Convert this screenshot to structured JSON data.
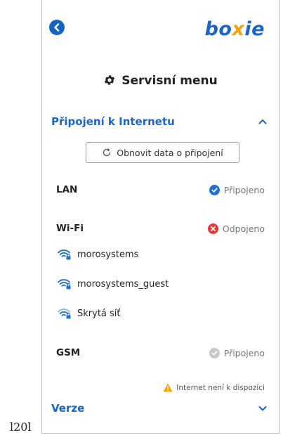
{
  "corner_label": "l20l",
  "header": {
    "logo": {
      "part1": "bo",
      "part2": "x",
      "part3": "ie"
    }
  },
  "title": "Servisní menu",
  "sections": {
    "internet": {
      "label": "Připojení k Internetu"
    },
    "version": {
      "label": "Verze"
    }
  },
  "refresh_button": {
    "label": "Obnovit data o připojení"
  },
  "lan": {
    "name": "LAN",
    "status": "Připojeno"
  },
  "wifi": {
    "name": "Wi-Fi",
    "status": "Odpojeno",
    "networks": [
      "morosystems",
      "morosystems_guest",
      "Skrytá síť"
    ]
  },
  "gsm": {
    "name": "GSM",
    "status": "Připojeno",
    "warning": "Internet není k dispozici"
  },
  "colors": {
    "accent": "#1b64c8",
    "success": "#1e6fd0",
    "error": "#e53935",
    "warning": "#f5a300",
    "disabled": "#c8c8c8"
  },
  "icons": [
    "back-arrow-icon",
    "gear-icon",
    "chevron-up-icon",
    "refresh-icon",
    "check-circle-icon",
    "x-circle-icon",
    "wifi-lock-icon",
    "warning-icon",
    "chevron-down-icon"
  ]
}
